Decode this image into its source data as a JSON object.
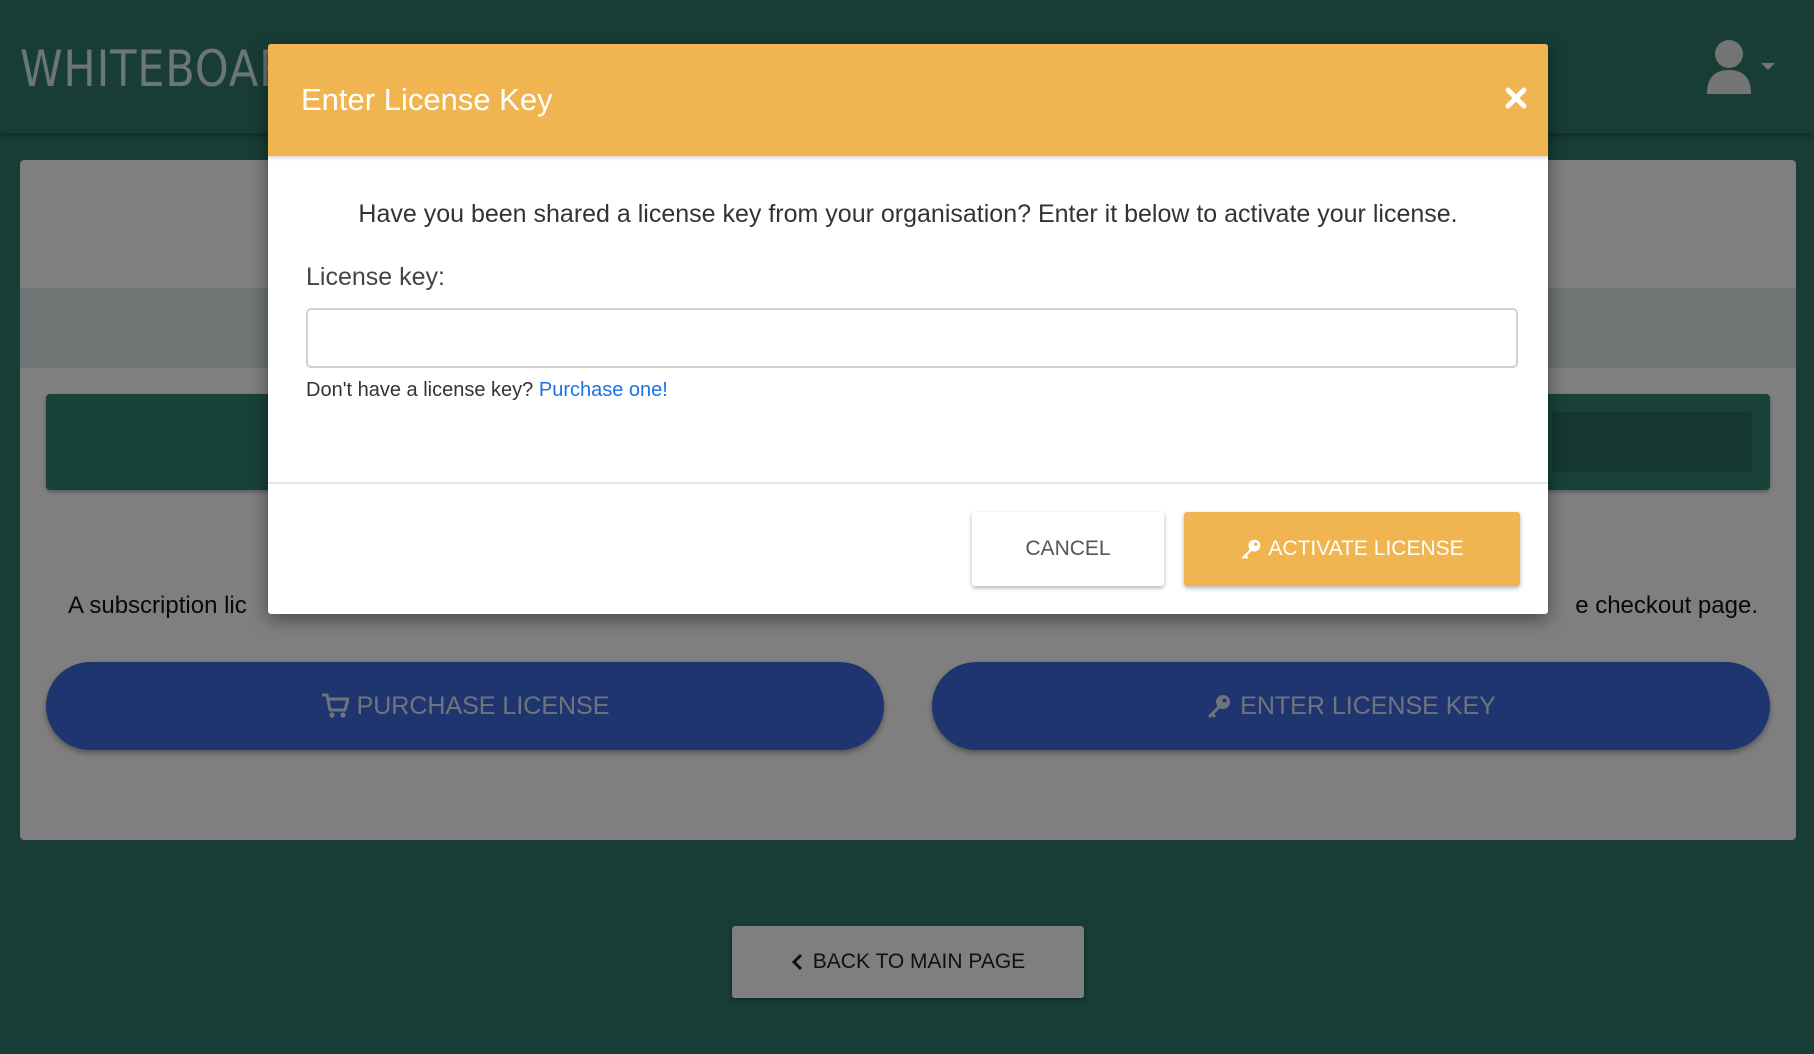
{
  "app": {
    "logo_text": "WHITEBOARD"
  },
  "header": {
    "user_icon": "user-icon",
    "menu_caret_icon": "caret-down-icon"
  },
  "page": {
    "subscription_text_start": "A subscription lic",
    "subscription_text_end": "e checkout page.",
    "purchase_label": "PURCHASE LICENSE",
    "enter_key_label": "ENTER LICENSE KEY",
    "back_label": "BACK TO MAIN PAGE"
  },
  "modal": {
    "title": "Enter License Key",
    "intro": "Have you been shared a license key from your organisation? Enter it below to activate your license.",
    "field_label": "License key:",
    "input_value": "",
    "help_text": "Don't have a license key?",
    "help_link": "Purchase one!",
    "cancel_label": "CANCEL",
    "activate_label": "ACTIVATE LICENSE"
  },
  "colors": {
    "brand_teal": "#2e7a6c",
    "accent_orange": "#f0b451",
    "primary_blue": "#3f6be0",
    "link_blue": "#1a73e8"
  }
}
